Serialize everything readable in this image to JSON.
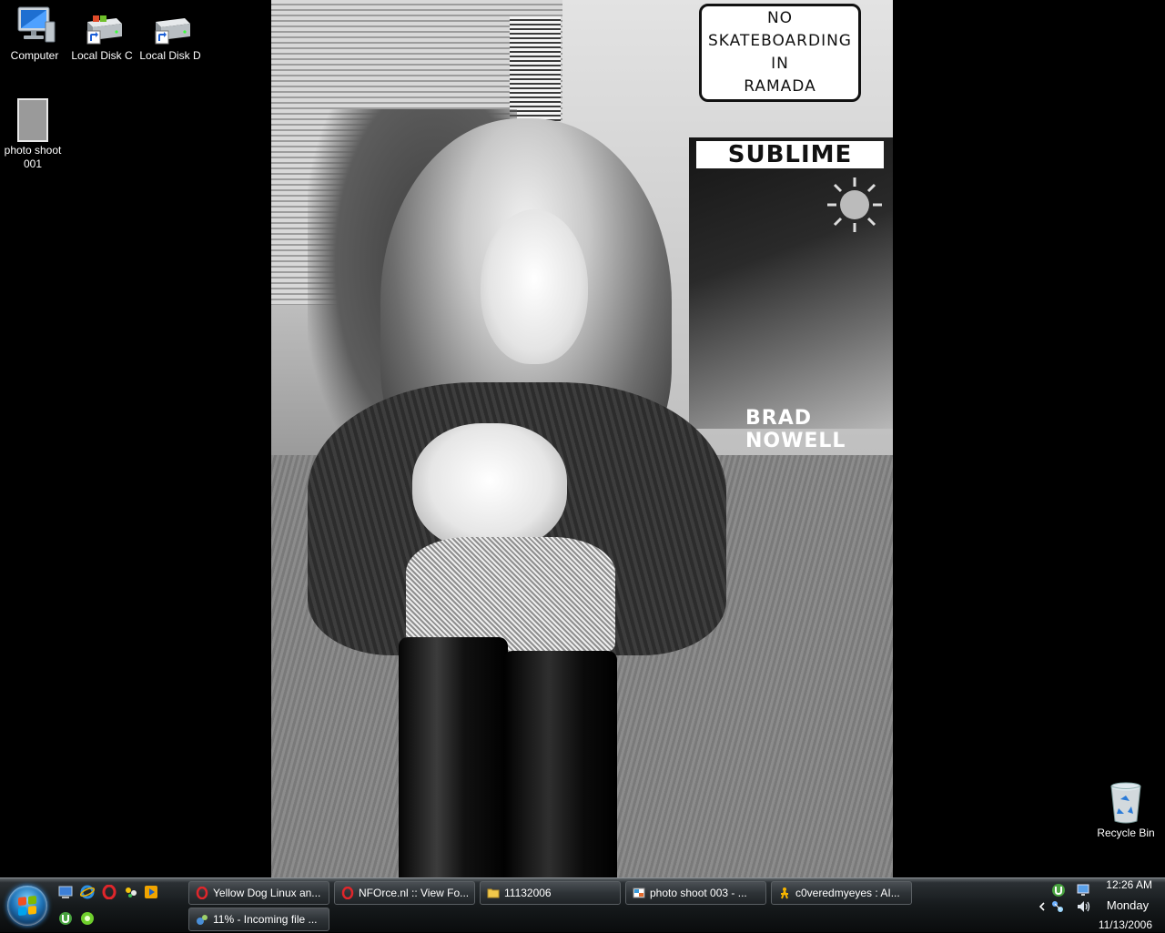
{
  "desktop": {
    "icons": [
      {
        "label": "Computer",
        "icon": "computer-icon"
      },
      {
        "label": "Local Disk C",
        "icon": "drive-shortcut-icon"
      },
      {
        "label": "Local Disk D",
        "icon": "drive-shortcut-icon"
      },
      {
        "label": "photo shoot 001",
        "icon": "image-file-icon"
      },
      {
        "label": "Recycle Bin",
        "icon": "recycle-bin-icon"
      }
    ]
  },
  "wallpaper": {
    "sign_lines": [
      "NO",
      "SKATEBOARDING",
      "IN",
      "RAMADA"
    ],
    "poster_title": "SUBLIME",
    "poster_bottom": "BRAD NOWELL"
  },
  "taskbar": {
    "quick_launch": [
      "show-desktop-icon",
      "internet-explorer-icon",
      "opera-icon",
      "messenger-icon",
      "media-player-icon",
      "utorrent-icon",
      "green-app-icon"
    ],
    "tasks": [
      {
        "label": "Yellow Dog Linux an...",
        "icon": "opera-icon"
      },
      {
        "label": "NFOrce.nl :: View Fo...",
        "icon": "opera-icon"
      },
      {
        "label": "11132006",
        "icon": "folder-icon"
      },
      {
        "label": "photo shoot 003 - ...",
        "icon": "photo-gallery-icon"
      },
      {
        "label": "c0veredmyeyes : AI...",
        "icon": "aim-icon"
      },
      {
        "label": "11% - Incoming file ...",
        "icon": "transfer-icon"
      }
    ],
    "tray": {
      "time": "12:26 AM",
      "day": "Monday",
      "date": "11/13/2006"
    }
  },
  "colors": {
    "taskbar": "#161a1c",
    "start_orb": "#1f74b8",
    "text": "#ffffff"
  }
}
